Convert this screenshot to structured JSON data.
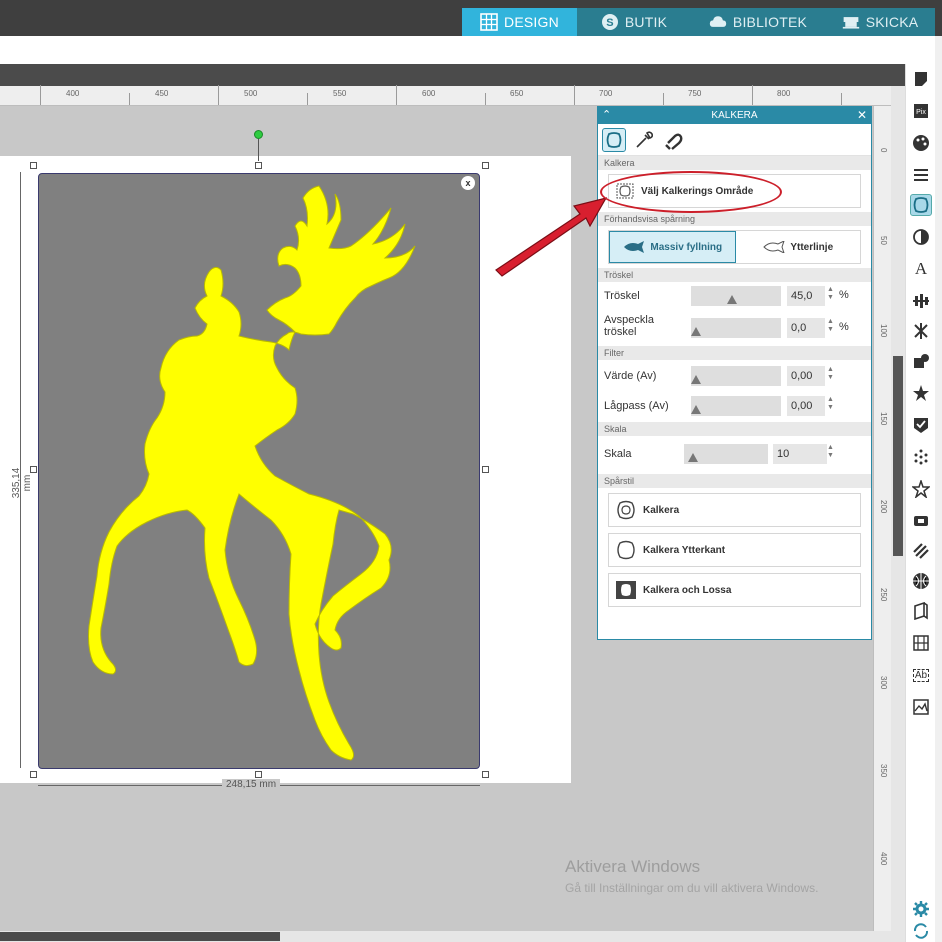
{
  "topbar": {
    "tabs": [
      {
        "label": "DESIGN",
        "icon": "grid-icon",
        "active": true
      },
      {
        "label": "BUTIK",
        "icon": "store-icon",
        "active": false
      },
      {
        "label": "BIBLIOTEK",
        "icon": "cloud-icon",
        "active": false
      },
      {
        "label": "SKICKA",
        "icon": "cutter-icon",
        "active": false
      }
    ]
  },
  "ruler": {
    "horizontal": [
      "400",
      "450",
      "500",
      "550",
      "600",
      "650",
      "700",
      "750",
      "800"
    ],
    "vertical": [
      "0",
      "50",
      "100",
      "150",
      "200",
      "250",
      "300",
      "350",
      "400"
    ]
  },
  "canvas": {
    "height_dim": "335,14 mm",
    "width_dim": "248,15 mm",
    "close_label": "x",
    "image_color": "#ffff00",
    "bg_color": "#808080"
  },
  "panel": {
    "title": "KALKERA",
    "tools": [
      "trace-area-icon",
      "eyedropper-icon",
      "magnet-icon"
    ],
    "section_kalkera": "Kalkera",
    "select_area_label": "Välj Kalkerings Område",
    "section_preview": "Förhandsvisa spårning",
    "preview_options": [
      {
        "label": "Massiv fyllning",
        "icon": "fish-solid-icon",
        "selected": true
      },
      {
        "label": "Ytterlinje",
        "icon": "fish-outline-icon",
        "selected": false
      }
    ],
    "section_threshold": "Tröskel",
    "threshold_label": "Tröskel",
    "threshold_value": "45,0",
    "threshold_unit": "%",
    "threshold_level": 45,
    "despeckle_label": "Avspeckla tröskel",
    "despeckle_value": "0,0",
    "despeckle_unit": "%",
    "section_filter": "Filter",
    "value_label": "Värde (Av)",
    "value_value": "0,00",
    "lowpass_label": "Lågpass (Av)",
    "lowpass_value": "0,00",
    "section_scale": "Skala",
    "scale_label": "Skala",
    "scale_value": "10",
    "section_style": "Spårstil",
    "style_buttons": [
      {
        "label": "Kalkera",
        "icon": "trace-icon"
      },
      {
        "label": "Kalkera Ytterkant",
        "icon": "trace-outer-icon"
      },
      {
        "label": "Kalkera och Lossa",
        "icon": "trace-detach-icon"
      }
    ]
  },
  "watermark": {
    "line1": "Aktivera Windows",
    "line2": "Gå till Inställningar om du vill aktivera Windows."
  },
  "colors": {
    "accent": "#31b4dc",
    "panel_accent": "#2a8aa6",
    "callout_red": "#cc1f2a"
  }
}
